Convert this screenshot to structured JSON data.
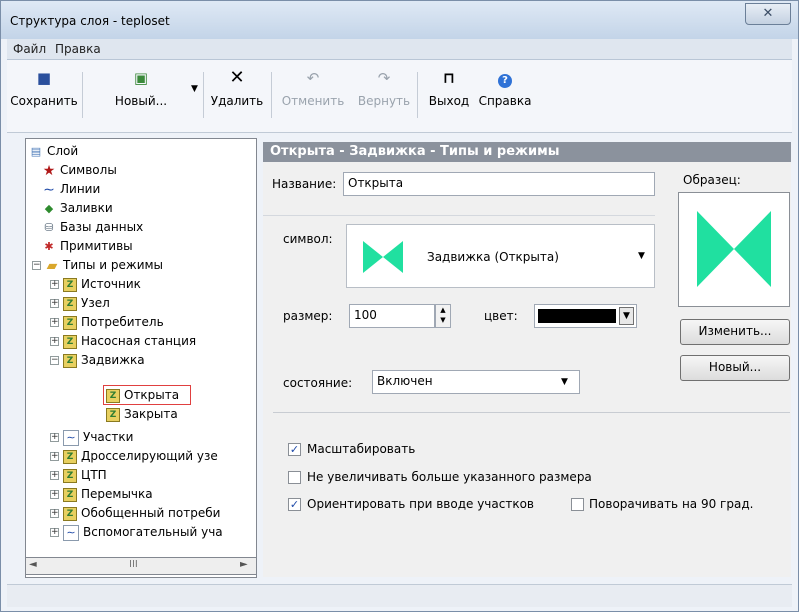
{
  "window": {
    "title": "Структура слоя - teploset",
    "close_glyph": "✕"
  },
  "menu": [
    "Файл",
    "Правка"
  ],
  "toolbar": {
    "save": "Сохранить",
    "new": "Новый...",
    "delete": "Удалить",
    "undo": "Отменить",
    "redo": "Вернуть",
    "exit": "Выход",
    "help": "Справка"
  },
  "tree": {
    "root": "Слой",
    "symbols": "Символы",
    "lines": "Линии",
    "fills": "Заливки",
    "databases": "Базы данных",
    "primitives": "Примитивы",
    "types": "Типы и режимы",
    "source": "Источник",
    "node": "Узел",
    "consumer": "Потребитель",
    "pump": "Насосная станция",
    "valve": "Задвижка",
    "open": "Открыта",
    "closed": "Закрыта",
    "sections": "Участки",
    "throttle": "Дросселирующий узе",
    "ctp": "ЦТП",
    "jumper": "Перемычка",
    "generalized": "Обобщенный потреби",
    "auxiliary": "Вспомогательный уча",
    "scroll_mark": "III"
  },
  "panel": {
    "header": "Открыта - Задвижка - Типы и режимы",
    "name_label": "Название:",
    "name_value": "Открыта",
    "sample_label": "Образец:",
    "symbol_label": "символ:",
    "symbol_value": "Задвижка (Открыта)",
    "size_label": "размер:",
    "size_value": "100",
    "color_label": "цвет:",
    "state_label": "состояние:",
    "state_value": "Включен",
    "change_btn": "Изменить...",
    "new_btn": "Новый...",
    "scale_label": "Масштабировать",
    "scale_checked": true,
    "no_enlarge_label": "Не увеличивать больше указанного размера",
    "no_enlarge_checked": false,
    "orient_label": "Ориентировать при вводе участков",
    "orient_checked": true,
    "rotate_label": "Поворачивать на 90 град.",
    "rotate_checked": false
  },
  "colors": {
    "symbol_green": "#20e0a0",
    "selected_color": "#000000",
    "header_bg": "#8b929d"
  }
}
